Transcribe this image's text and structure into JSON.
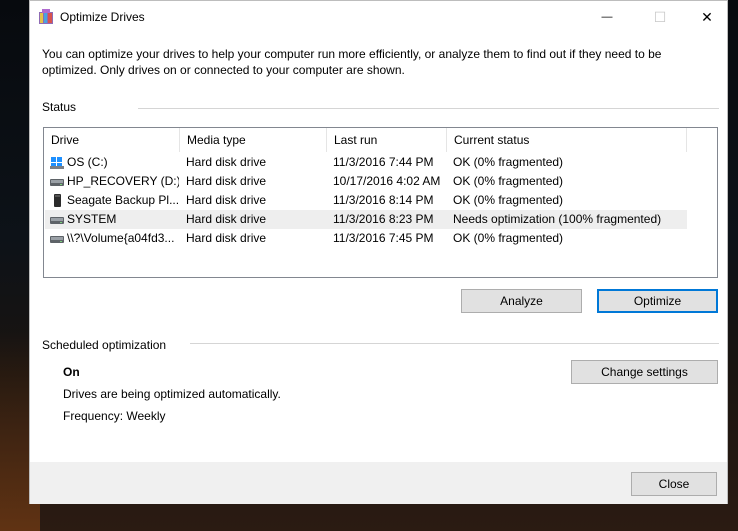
{
  "window": {
    "title": "Optimize Drives",
    "minimize_glyph": "—",
    "maximize_glyph": "☐",
    "close_glyph": "✕"
  },
  "description": "You can optimize your drives to help your computer run more efficiently, or analyze them to find out if they need to be optimized. Only drives on or connected to your computer are shown.",
  "status": {
    "label": "Status",
    "columns": [
      "Drive",
      "Media type",
      "Last run",
      "Current status"
    ],
    "rows": [
      {
        "drive": "OS (C:)",
        "icon": "windows-drive-icon",
        "media": "Hard disk drive",
        "last_run": "11/3/2016 7:44 PM",
        "status": "OK (0% fragmented)"
      },
      {
        "drive": "HP_RECOVERY (D:)",
        "icon": "hard-drive-icon",
        "media": "Hard disk drive",
        "last_run": "10/17/2016 4:02 AM",
        "status": "OK (0% fragmented)"
      },
      {
        "drive": "Seagate Backup Pl...",
        "icon": "external-drive-icon",
        "media": "Hard disk drive",
        "last_run": "11/3/2016 8:14 PM",
        "status": "OK (0% fragmented)"
      },
      {
        "drive": "SYSTEM",
        "icon": "hard-drive-icon",
        "media": "Hard disk drive",
        "last_run": "11/3/2016 8:23 PM",
        "status": "Needs optimization (100% fragmented)"
      },
      {
        "drive": "\\\\?\\Volume{a04fd3...",
        "icon": "hard-drive-icon",
        "media": "Hard disk drive",
        "last_run": "11/3/2016 7:45 PM",
        "status": "OK (0% fragmented)"
      }
    ],
    "analyze_label": "Analyze",
    "optimize_label": "Optimize"
  },
  "scheduled": {
    "label": "Scheduled optimization",
    "state": "On",
    "line1": "Drives are being optimized automatically.",
    "line2": "Frequency: Weekly",
    "change_label": "Change settings"
  },
  "footer": {
    "close_label": "Close"
  },
  "colors": {
    "accent": "#0078d7",
    "window_bg": "#f0f0f0",
    "content_bg": "#ffffff"
  }
}
